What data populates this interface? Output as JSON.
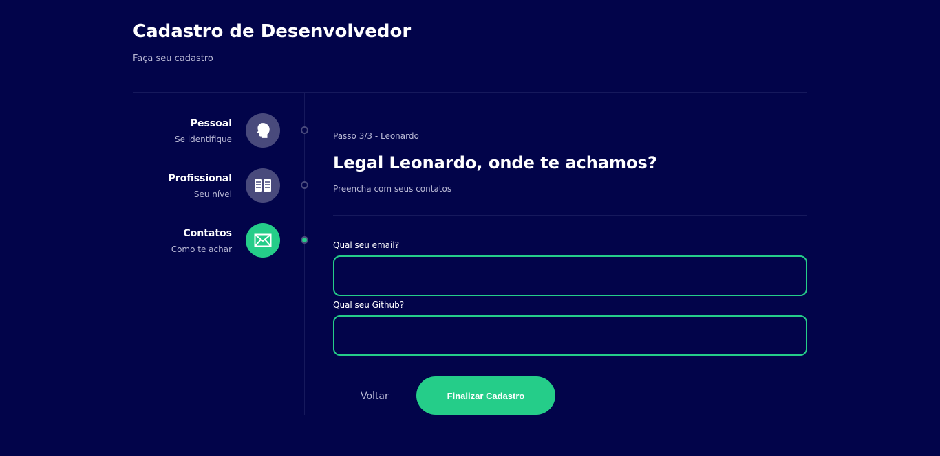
{
  "header": {
    "title": "Cadastro de Desenvolvedor",
    "subtitle": "Faça seu cadastro"
  },
  "steps": [
    {
      "title": "Pessoal",
      "description": "Se identifique",
      "icon": "person-head-icon",
      "active": false
    },
    {
      "title": "Profissional",
      "description": "Seu nível",
      "icon": "book-icon",
      "active": false
    },
    {
      "title": "Contatos",
      "description": "Como te achar",
      "icon": "mail-icon",
      "active": true
    }
  ],
  "main": {
    "step_counter": "Passo 3/3 - Leonardo",
    "title": "Legal Leonardo, onde te achamos?",
    "description": "Preencha com seus contatos",
    "email": {
      "label": "Qual seu email?",
      "value": ""
    },
    "github": {
      "label": "Qual seu Github?",
      "value": ""
    },
    "back_label": "Voltar",
    "finish_label": "Finalizar Cadastro"
  },
  "colors": {
    "background": "#02044A",
    "accent": "#25CD89",
    "inactive": "#494A7C",
    "muted_text": "#B8B8D4"
  }
}
